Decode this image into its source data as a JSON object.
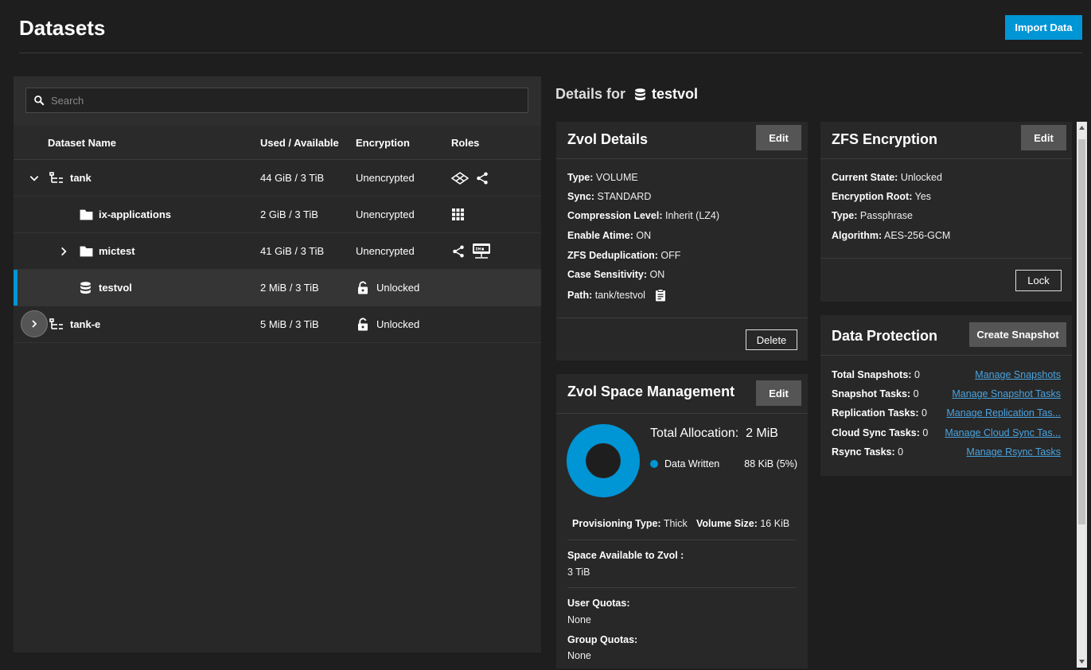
{
  "page": {
    "title": "Datasets",
    "import_label": "Import Data"
  },
  "search": {
    "placeholder": "Search"
  },
  "table": {
    "headers": [
      "Dataset Name",
      "Used / Available",
      "Encryption",
      "Roles"
    ],
    "rows": [
      {
        "name": "tank",
        "used": "44 GiB / 3 TiB",
        "encryption": "Unencrypted"
      },
      {
        "name": "ix-applications",
        "used": "2 GiB / 3 TiB",
        "encryption": "Unencrypted"
      },
      {
        "name": "mictest",
        "used": "41 GiB / 3 TiB",
        "encryption": "Unencrypted"
      },
      {
        "name": "testvol",
        "used": "2 MiB / 3 TiB",
        "encryption": "Unlocked"
      },
      {
        "name": "tank-e",
        "used": "5 MiB / 3 TiB",
        "encryption": "Unlocked"
      }
    ]
  },
  "details": {
    "prefix": "Details for",
    "name": "testvol",
    "zvol": {
      "title": "Zvol Details",
      "edit": "Edit",
      "delete": "Delete",
      "fields": [
        {
          "k": "Type:",
          "v": "VOLUME"
        },
        {
          "k": "Sync:",
          "v": "STANDARD"
        },
        {
          "k": "Compression Level:",
          "v": "Inherit (LZ4)"
        },
        {
          "k": "Enable Atime:",
          "v": "ON"
        },
        {
          "k": "ZFS Deduplication:",
          "v": "OFF"
        },
        {
          "k": "Case Sensitivity:",
          "v": "ON"
        },
        {
          "k": "Path:",
          "v": "tank/testvol"
        }
      ]
    },
    "space": {
      "title": "Zvol Space Management",
      "edit": "Edit",
      "total_label": "Total Allocation:",
      "total_value": "2 MiB",
      "legend_label": "Data Written",
      "legend_value": "88 KiB (5%)",
      "written_fraction": 0.05,
      "prov_label": "Provisioning Type:",
      "prov_value": "Thick",
      "vsize_label": "Volume Size:",
      "vsize_value": "16 KiB",
      "avail_label": "Space Available to Zvol :",
      "avail_value": "3 TiB",
      "uq_label": "User Quotas:",
      "uq_value": "None",
      "gq_label": "Group Quotas:",
      "gq_value": "None",
      "colors": {
        "written": "#0095d5",
        "hole": "#1e1e1e"
      }
    },
    "encryption": {
      "title": "ZFS Encryption",
      "edit": "Edit",
      "lock": "Lock",
      "fields": [
        {
          "k": "Current State:",
          "v": "Unlocked"
        },
        {
          "k": "Encryption Root:",
          "v": "Yes"
        },
        {
          "k": "Type:",
          "v": "Passphrase"
        },
        {
          "k": "Algorithm:",
          "v": "AES-256-GCM"
        }
      ]
    },
    "protection": {
      "title": "Data Protection",
      "create": "Create Snapshot",
      "items": [
        {
          "k": "Total Snapshots:",
          "v": "0",
          "link": "Manage Snapshots"
        },
        {
          "k": "Snapshot Tasks:",
          "v": "0",
          "link": "Manage Snapshot Tasks"
        },
        {
          "k": "Replication Tasks:",
          "v": "0",
          "link": "Manage Replication Tas..."
        },
        {
          "k": "Cloud Sync Tasks:",
          "v": "0",
          "link": "Manage Cloud Sync Tas..."
        },
        {
          "k": "Rsync Tasks:",
          "v": "0",
          "link": "Manage Rsync Tasks"
        }
      ]
    }
  },
  "colors": {
    "accent": "#0095d5",
    "link": "#4aa3df"
  }
}
